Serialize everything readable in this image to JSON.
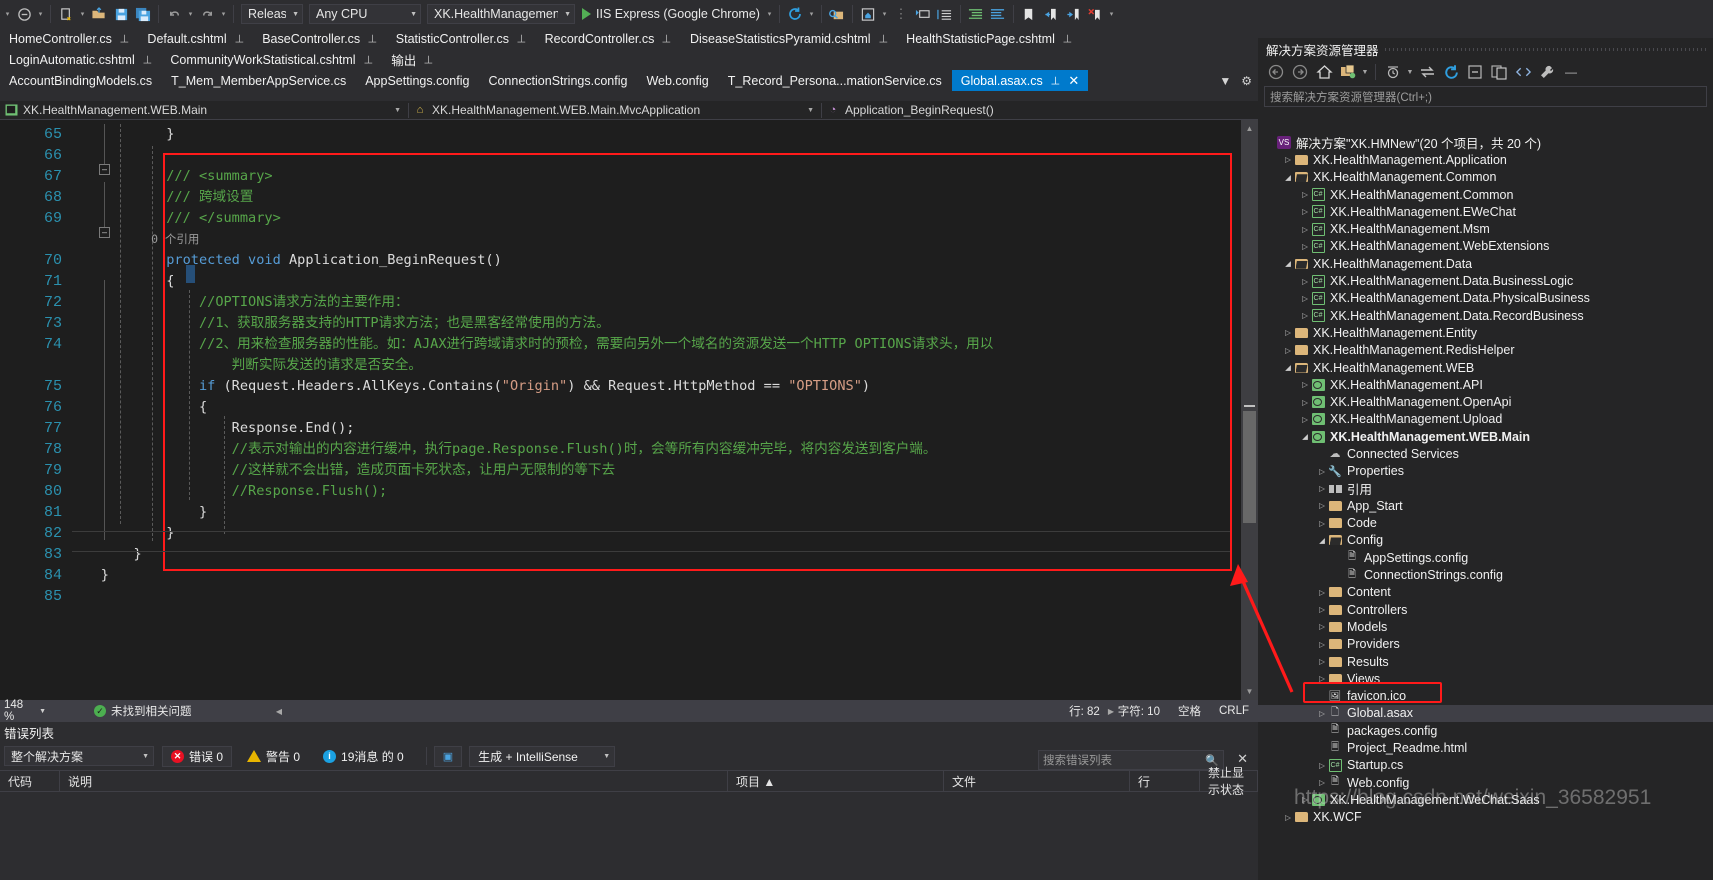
{
  "toolbar": {
    "config_label": "Release",
    "platform_label": "Any CPU",
    "startup_project": "XK.HealthManagement.WEB.Ma",
    "run_label": "IIS Express (Google Chrome)",
    "icons": [
      "navigate-back-icon",
      "new-item-icon",
      "open-file-icon",
      "save-icon",
      "save-all-icon",
      "undo-icon",
      "redo-icon",
      "find-icon",
      "home-icon",
      "step-icon",
      "indent-icon",
      "outdent-icon",
      "bookmark-icon",
      "prev-bookmark-icon",
      "next-bookmark-icon",
      "clear-bookmark-icon"
    ]
  },
  "tabs": {
    "row1": [
      {
        "label": "HomeController.cs",
        "pinned": true
      },
      {
        "label": "Default.cshtml",
        "pinned": true
      },
      {
        "label": "BaseController.cs",
        "pinned": true
      },
      {
        "label": "StatisticController.cs",
        "pinned": true
      },
      {
        "label": "RecordController.cs",
        "pinned": true
      },
      {
        "label": "DiseaseStatisticsPyramid.cshtml",
        "pinned": true
      },
      {
        "label": "HealthStatisticPage.cshtml",
        "pinned": true
      }
    ],
    "row2": [
      {
        "label": "LoginAutomatic.cshtml",
        "pinned": true
      },
      {
        "label": "CommunityWorkStatistical.cshtml",
        "pinned": true
      },
      {
        "label": "输出",
        "pinned": true
      }
    ],
    "row3": [
      {
        "label": "AccountBindingModels.cs",
        "pinned": false
      },
      {
        "label": "T_Mem_MemberAppService.cs",
        "pinned": false
      },
      {
        "label": "AppSettings.config",
        "pinned": false
      },
      {
        "label": "ConnectionStrings.config",
        "pinned": false
      },
      {
        "label": "Web.config",
        "pinned": false
      },
      {
        "label": "T_Record_Persona...mationService.cs",
        "pinned": false
      },
      {
        "label": "Global.asax.cs",
        "pinned": true,
        "active": true,
        "close": "✕"
      }
    ]
  },
  "navbar": {
    "project": "XK.HealthManagement.WEB.Main",
    "type": "XK.HealthManagement.WEB.Main.MvcApplication",
    "member": "Application_BeginRequest()"
  },
  "editor": {
    "line_numbers": [
      "65",
      "66",
      "67",
      "68",
      "69",
      "70",
      "71",
      "72",
      "73",
      "74",
      "75",
      "76",
      "77",
      "78",
      "79",
      "80",
      "81",
      "82",
      "83",
      "84",
      "85"
    ],
    "lines": [
      {
        "n": "65",
        "parts": [
          {
            "t": "            }",
            "c": "c-pln"
          }
        ]
      },
      {
        "n": "66",
        "parts": []
      },
      {
        "n": "67",
        "parts": [
          {
            "t": "            /// <summary>",
            "c": "c-cmt"
          }
        ]
      },
      {
        "n": "68",
        "parts": [
          {
            "t": "            /// 跨域设置",
            "c": "c-cmt"
          }
        ]
      },
      {
        "n": "69",
        "parts": [
          {
            "t": "            /// </summary>",
            "c": "c-cmt"
          }
        ]
      },
      {
        "n": "ref",
        "parts": [
          {
            "t": "            0 个引用",
            "c": "c-ref"
          }
        ]
      },
      {
        "n": "70",
        "parts": [
          {
            "t": "            protected void ",
            "c": "c-kw"
          },
          {
            "t": "Application_BeginRequest()",
            "c": "c-pln"
          }
        ]
      },
      {
        "n": "71",
        "parts": [
          {
            "t": "            {",
            "c": "c-pln"
          }
        ]
      },
      {
        "n": "72",
        "parts": [
          {
            "t": "                //OPTIONS请求方法的主要作用：",
            "c": "c-cmt"
          }
        ]
      },
      {
        "n": "73",
        "parts": [
          {
            "t": "                //1、获取服务器支持的HTTP请求方法；也是黑客经常使用的方法。",
            "c": "c-cmt"
          }
        ]
      },
      {
        "n": "74",
        "parts": [
          {
            "t": "                //2、用来检查服务器的性能。如：AJAX进行跨域请求时的预检，需要向另外一个域名的资源发送一个HTTP OPTIONS请求头，用以",
            "c": "c-cmt"
          }
        ]
      },
      {
        "n": "74b",
        "parts": [
          {
            "t": "                    判断实际发送的请求是否安全。",
            "c": "c-cmt"
          }
        ]
      },
      {
        "n": "75",
        "parts": [
          {
            "t": "                if ",
            "c": "c-kw"
          },
          {
            "t": "(Request.Headers.AllKeys.Contains(",
            "c": "c-pln"
          },
          {
            "t": "\"Origin\"",
            "c": "c-str"
          },
          {
            "t": ") && Request.HttpMethod == ",
            "c": "c-pln"
          },
          {
            "t": "\"OPTIONS\"",
            "c": "c-str"
          },
          {
            "t": ")",
            "c": "c-pln"
          }
        ]
      },
      {
        "n": "76",
        "parts": [
          {
            "t": "                {",
            "c": "c-pln"
          }
        ]
      },
      {
        "n": "77",
        "parts": [
          {
            "t": "                    Response.End();",
            "c": "c-pln"
          }
        ]
      },
      {
        "n": "78",
        "parts": [
          {
            "t": "                    //表示对输出的内容进行缓冲，执行page.Response.Flush()时，会等所有内容缓冲完毕，将内容发送到客户端。",
            "c": "c-cmt"
          }
        ]
      },
      {
        "n": "79",
        "parts": [
          {
            "t": "                    //这样就不会出错，造成页面卡死状态，让用户无限制的等下去",
            "c": "c-cmt"
          }
        ]
      },
      {
        "n": "80",
        "parts": [
          {
            "t": "                    //Response.Flush();",
            "c": "c-cmt"
          }
        ]
      },
      {
        "n": "81",
        "parts": [
          {
            "t": "                }",
            "c": "c-pln"
          }
        ]
      },
      {
        "n": "82",
        "parts": [
          {
            "t": "            }",
            "c": "c-pln"
          }
        ]
      },
      {
        "n": "83",
        "parts": [
          {
            "t": "        }",
            "c": "c-pln"
          }
        ]
      },
      {
        "n": "84",
        "parts": [
          {
            "t": "    }",
            "c": "c-pln"
          }
        ]
      },
      {
        "n": "85",
        "parts": []
      }
    ]
  },
  "editor_status": {
    "zoom": "148 %",
    "issues": "未找到相关问题",
    "line": "行: 82",
    "col": "字符: 10",
    "spaces": "空格",
    "eol": "CRLF"
  },
  "error_list": {
    "title": "错误列表",
    "scope": "整个解决方案",
    "errors": "错误 0",
    "warnings": "警告 0",
    "messages": "19消息 的 0",
    "build_filter": "生成 + IntelliSense",
    "search_placeholder": "搜索错误列表",
    "columns": [
      "代码",
      "说明",
      "项目 ▲",
      "文件",
      "行",
      "禁止显示状态"
    ]
  },
  "solution_explorer": {
    "title": "解决方案资源管理器",
    "search_placeholder": "搜索解决方案资源管理器(Ctrl+;)",
    "tree": [
      {
        "indent": 0,
        "arrow": "",
        "icon": "solution-icon",
        "label": "解决方案\"XK.HMNew\"(20 个项目，共 20 个)"
      },
      {
        "indent": 1,
        "arrow": "▷",
        "icon": "folder-icon",
        "label": "XK.HealthManagement.Application"
      },
      {
        "indent": 1,
        "arrow": "◢",
        "icon": "folder-open-icon",
        "label": "XK.HealthManagement.Common"
      },
      {
        "indent": 2,
        "arrow": "▷",
        "icon": "csharp-icon",
        "label": "XK.HealthManagement.Common"
      },
      {
        "indent": 2,
        "arrow": "▷",
        "icon": "csharp-icon",
        "label": "XK.HealthManagement.EWeChat"
      },
      {
        "indent": 2,
        "arrow": "▷",
        "icon": "csharp-icon",
        "label": "XK.HealthManagement.Msm"
      },
      {
        "indent": 2,
        "arrow": "▷",
        "icon": "csharp-icon",
        "label": "XK.HealthManagement.WebExtensions"
      },
      {
        "indent": 1,
        "arrow": "◢",
        "icon": "folder-open-icon",
        "label": "XK.HealthManagement.Data"
      },
      {
        "indent": 2,
        "arrow": "▷",
        "icon": "csharp-icon",
        "label": "XK.HealthManagement.Data.BusinessLogic"
      },
      {
        "indent": 2,
        "arrow": "▷",
        "icon": "csharp-icon",
        "label": "XK.HealthManagement.Data.PhysicalBusiness"
      },
      {
        "indent": 2,
        "arrow": "▷",
        "icon": "csharp-icon",
        "label": "XK.HealthManagement.Data.RecordBusiness"
      },
      {
        "indent": 1,
        "arrow": "▷",
        "icon": "folder-icon",
        "label": "XK.HealthManagement.Entity"
      },
      {
        "indent": 1,
        "arrow": "▷",
        "icon": "folder-icon",
        "label": "XK.HealthManagement.RedisHelper"
      },
      {
        "indent": 1,
        "arrow": "◢",
        "icon": "folder-open-icon",
        "label": "XK.HealthManagement.WEB"
      },
      {
        "indent": 2,
        "arrow": "▷",
        "icon": "web-project-icon",
        "label": "XK.HealthManagement.API"
      },
      {
        "indent": 2,
        "arrow": "▷",
        "icon": "web-project-icon",
        "label": "XK.HealthManagement.OpenApi"
      },
      {
        "indent": 2,
        "arrow": "▷",
        "icon": "web-project-icon",
        "label": "XK.HealthManagement.Upload"
      },
      {
        "indent": 2,
        "arrow": "◢",
        "icon": "web-project-icon",
        "label": "XK.HealthManagement.WEB.Main",
        "bold": true
      },
      {
        "indent": 3,
        "arrow": "",
        "icon": "connected-services-icon",
        "label": "Connected Services"
      },
      {
        "indent": 3,
        "arrow": "▷",
        "icon": "wrench-icon",
        "label": "Properties"
      },
      {
        "indent": 3,
        "arrow": "▷",
        "icon": "references-icon",
        "label": "引用"
      },
      {
        "indent": 3,
        "arrow": "▷",
        "icon": "folder-icon",
        "label": "App_Start"
      },
      {
        "indent": 3,
        "arrow": "▷",
        "icon": "folder-icon",
        "label": "Code"
      },
      {
        "indent": 3,
        "arrow": "◢",
        "icon": "folder-open-icon",
        "label": "Config"
      },
      {
        "indent": 4,
        "arrow": "",
        "icon": "config-file-icon",
        "label": "AppSettings.config"
      },
      {
        "indent": 4,
        "arrow": "",
        "icon": "config-file-icon",
        "label": "ConnectionStrings.config"
      },
      {
        "indent": 3,
        "arrow": "▷",
        "icon": "folder-icon",
        "label": "Content"
      },
      {
        "indent": 3,
        "arrow": "▷",
        "icon": "folder-icon",
        "label": "Controllers"
      },
      {
        "indent": 3,
        "arrow": "▷",
        "icon": "folder-icon",
        "label": "Models"
      },
      {
        "indent": 3,
        "arrow": "▷",
        "icon": "folder-icon",
        "label": "Providers"
      },
      {
        "indent": 3,
        "arrow": "▷",
        "icon": "folder-icon",
        "label": "Results"
      },
      {
        "indent": 3,
        "arrow": "▷",
        "icon": "folder-icon",
        "label": "Views"
      },
      {
        "indent": 3,
        "arrow": "",
        "icon": "image-file-icon",
        "label": "favicon.ico"
      },
      {
        "indent": 3,
        "arrow": "▷",
        "icon": "asax-file-icon",
        "label": "Global.asax",
        "selected": true,
        "highlighted": true
      },
      {
        "indent": 3,
        "arrow": "",
        "icon": "config-file-icon",
        "label": "packages.config"
      },
      {
        "indent": 3,
        "arrow": "",
        "icon": "html-file-icon",
        "label": "Project_Readme.html"
      },
      {
        "indent": 3,
        "arrow": "▷",
        "icon": "csharp-file-icon",
        "label": "Startup.cs"
      },
      {
        "indent": 3,
        "arrow": "▷",
        "icon": "config-file-icon",
        "label": "Web.config"
      },
      {
        "indent": 2,
        "arrow": "▷",
        "icon": "web-project-icon",
        "label": "XK.HealthManagement.WeChat.Saas"
      },
      {
        "indent": 1,
        "arrow": "▷",
        "icon": "folder-icon",
        "label": "XK.WCF"
      }
    ]
  },
  "watermark": "https://blog.csdn.net/weixin_36582951"
}
